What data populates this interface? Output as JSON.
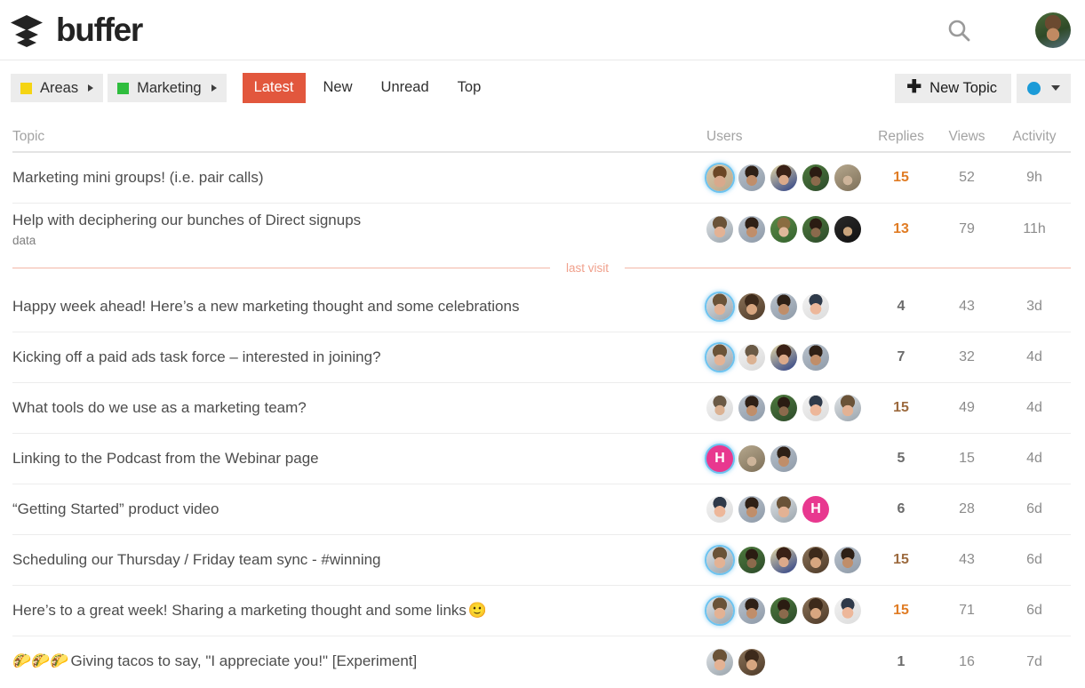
{
  "header": {
    "brand_name": "buffer",
    "logo_icon": "layers-stack-icon",
    "search_icon": "search-icon",
    "menu_icon": "hamburger-menu-icon",
    "avatar_icon": "user-avatar"
  },
  "nav": {
    "breadcrumbs": [
      {
        "label": "Areas",
        "color": "#f5d413",
        "caret": "chevron-right-icon"
      },
      {
        "label": "Marketing",
        "color": "#2fbd3e",
        "caret": "chevron-right-icon"
      }
    ],
    "tabs": [
      {
        "label": "Latest",
        "active": true
      },
      {
        "label": "New",
        "active": false
      },
      {
        "label": "Unread",
        "active": false
      },
      {
        "label": "Top",
        "active": false
      }
    ],
    "active_tab_color": "#e2573d",
    "new_topic_label": "New Topic",
    "new_topic_icon": "plus-icon",
    "category_dot_color": "#1b9bd8",
    "category_caret": "chevron-down-icon"
  },
  "table": {
    "columns": {
      "topic": "Topic",
      "users": "Users",
      "replies": "Replies",
      "views": "Views",
      "activity": "Activity"
    },
    "last_visit_label": "last visit",
    "last_visit_after_row": 1,
    "rows": [
      {
        "title": "Marketing mini groups! (i.e. pair calls)",
        "tag": "",
        "emoji_prefix": "",
        "emoji_suffix": "",
        "avatars": [
          {
            "type": "photo",
            "style": "a1",
            "ring": true
          },
          {
            "type": "photo",
            "style": "a2",
            "ring": false
          },
          {
            "type": "photo",
            "style": "a3",
            "ring": false
          },
          {
            "type": "photo",
            "style": "a4",
            "ring": false
          },
          {
            "type": "photo",
            "style": "a5",
            "ring": false
          }
        ],
        "replies": "15",
        "replies_heat": "hot2",
        "views": "52",
        "activity": "9h"
      },
      {
        "title": "Help with deciphering our bunches of Direct signups",
        "tag": "data",
        "emoji_prefix": "",
        "emoji_suffix": "",
        "avatars": [
          {
            "type": "photo",
            "style": "a6",
            "ring": false
          },
          {
            "type": "photo",
            "style": "a2",
            "ring": false
          },
          {
            "type": "photo",
            "style": "a7",
            "ring": false
          },
          {
            "type": "photo",
            "style": "a4",
            "ring": false
          },
          {
            "type": "photo",
            "style": "a8",
            "ring": false
          }
        ],
        "replies": "13",
        "replies_heat": "hot2",
        "views": "79",
        "activity": "11h"
      },
      {
        "title": "Happy week ahead! Here’s a new marketing thought and some celebrations",
        "tag": "",
        "emoji_prefix": "",
        "emoji_suffix": "",
        "avatars": [
          {
            "type": "photo",
            "style": "a6",
            "ring": true
          },
          {
            "type": "photo",
            "style": "a9",
            "ring": false
          },
          {
            "type": "photo",
            "style": "a2",
            "ring": false
          },
          {
            "type": "photo",
            "style": "a10",
            "ring": false
          }
        ],
        "replies": "4",
        "replies_heat": "",
        "views": "43",
        "activity": "3d"
      },
      {
        "title": "Kicking off a paid ads task force – interested in joining?",
        "tag": "",
        "emoji_prefix": "",
        "emoji_suffix": "",
        "avatars": [
          {
            "type": "photo",
            "style": "a6",
            "ring": true
          },
          {
            "type": "photo",
            "style": "a11",
            "ring": false
          },
          {
            "type": "photo",
            "style": "a3",
            "ring": false
          },
          {
            "type": "photo",
            "style": "a2",
            "ring": false
          }
        ],
        "replies": "7",
        "replies_heat": "",
        "views": "32",
        "activity": "4d"
      },
      {
        "title": "What tools do we use as a marketing team?",
        "tag": "",
        "emoji_prefix": "",
        "emoji_suffix": "",
        "avatars": [
          {
            "type": "photo",
            "style": "a11",
            "ring": false
          },
          {
            "type": "photo",
            "style": "a2",
            "ring": false
          },
          {
            "type": "photo",
            "style": "a4",
            "ring": false
          },
          {
            "type": "photo",
            "style": "a10",
            "ring": false
          },
          {
            "type": "photo",
            "style": "a6",
            "ring": false
          }
        ],
        "replies": "15",
        "replies_heat": "hot1",
        "views": "49",
        "activity": "4d"
      },
      {
        "title": "Linking to the Podcast from the Webinar page",
        "tag": "",
        "emoji_prefix": "",
        "emoji_suffix": "",
        "avatars": [
          {
            "type": "letter",
            "letter": "H",
            "ring": true
          },
          {
            "type": "photo",
            "style": "a5",
            "ring": false
          },
          {
            "type": "photo",
            "style": "a2",
            "ring": false
          }
        ],
        "replies": "5",
        "replies_heat": "",
        "views": "15",
        "activity": "4d"
      },
      {
        "title": "“Getting Started” product video",
        "tag": "",
        "emoji_prefix": "",
        "emoji_suffix": "",
        "avatars": [
          {
            "type": "photo",
            "style": "a10",
            "ring": false
          },
          {
            "type": "photo",
            "style": "a2",
            "ring": false
          },
          {
            "type": "photo",
            "style": "a6",
            "ring": false
          },
          {
            "type": "letter",
            "letter": "H",
            "ring": false
          }
        ],
        "replies": "6",
        "replies_heat": "",
        "views": "28",
        "activity": "6d"
      },
      {
        "title": "Scheduling our Thursday / Friday team sync - #winning",
        "tag": "",
        "emoji_prefix": "",
        "emoji_suffix": "",
        "avatars": [
          {
            "type": "photo",
            "style": "a6",
            "ring": true
          },
          {
            "type": "photo",
            "style": "a4",
            "ring": false
          },
          {
            "type": "photo",
            "style": "a3",
            "ring": false
          },
          {
            "type": "photo",
            "style": "a9",
            "ring": false
          },
          {
            "type": "photo",
            "style": "a2",
            "ring": false
          }
        ],
        "replies": "15",
        "replies_heat": "hot1",
        "views": "43",
        "activity": "6d"
      },
      {
        "title": "Here’s to a great week! Sharing a marketing thought and some links",
        "tag": "",
        "emoji_prefix": "",
        "emoji_suffix": "🙂",
        "avatars": [
          {
            "type": "photo",
            "style": "a6",
            "ring": true
          },
          {
            "type": "photo",
            "style": "a2",
            "ring": false
          },
          {
            "type": "photo",
            "style": "a4",
            "ring": false
          },
          {
            "type": "photo",
            "style": "a9",
            "ring": false
          },
          {
            "type": "photo",
            "style": "a10",
            "ring": false
          }
        ],
        "replies": "15",
        "replies_heat": "hot2",
        "views": "71",
        "activity": "6d"
      },
      {
        "title": "Giving tacos to say, \"I appreciate you!\" [Experiment]",
        "tag": "",
        "emoji_prefix": "🌮🌮🌮",
        "emoji_suffix": "",
        "avatars": [
          {
            "type": "photo",
            "style": "a6",
            "ring": false
          },
          {
            "type": "photo",
            "style": "a9",
            "ring": false
          }
        ],
        "replies": "1",
        "replies_heat": "",
        "views": "16",
        "activity": "7d"
      }
    ]
  }
}
